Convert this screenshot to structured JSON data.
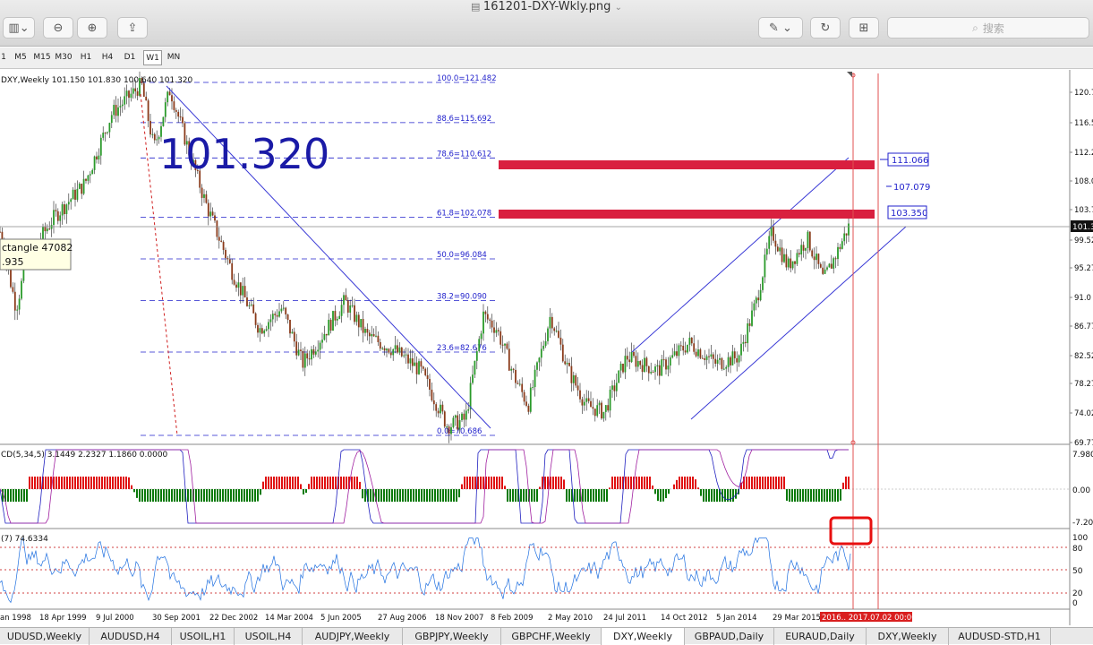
{
  "window": {
    "title": "161201-DXY-Wkly.png",
    "search_placeholder": "搜索"
  },
  "timeframes": [
    {
      "label": "1"
    },
    {
      "label": "M5"
    },
    {
      "label": "M15"
    },
    {
      "label": "M30"
    },
    {
      "label": "H1"
    },
    {
      "label": "H4"
    },
    {
      "label": "D1"
    },
    {
      "label": "W1"
    },
    {
      "label": "MN"
    }
  ],
  "chart": {
    "header": "DXY,Weekly  101.150 101.830 100.640 101.320",
    "big_label": "101.320",
    "tooltip": {
      "line1": "ctangle 47082",
      "line2": ".935"
    },
    "price_axis": [
      "120.7",
      "116.5",
      "112.2",
      "108.0",
      "103.7",
      "99.52",
      "95.27",
      "91.0",
      "86.77",
      "82.52",
      "78.27",
      "74.02",
      "69.77"
    ],
    "current_price": "101.3",
    "fib_levels": [
      {
        "label": "100.0=121.482",
        "price": 121.482
      },
      {
        "label": "88.6=115.692",
        "price": 115.692
      },
      {
        "label": "78.6=110.612",
        "price": 110.612
      },
      {
        "label": "61.8=102.078",
        "price": 102.078
      },
      {
        "label": "50.0=96.084",
        "price": 96.084
      },
      {
        "label": "38.2=90.090",
        "price": 90.09
      },
      {
        "label": "23.6=82.676",
        "price": 82.676
      },
      {
        "label": "0.0=70.686",
        "price": 70.686
      }
    ],
    "boxes": [
      "111.066",
      "107.079",
      "103.350"
    ],
    "macd": {
      "header": "CD(5,34,5) 3.1449 2.2327 1.1860 0.0000",
      "axis": [
        "7.980",
        "0.00",
        "-7.201"
      ]
    },
    "stoch": {
      "header": "(7) 74.6334",
      "axis": [
        "100",
        "80",
        "50",
        "20",
        "0"
      ]
    },
    "dates": [
      "an 1998",
      "18 Apr 1999",
      "9 Jul 2000",
      "30 Sep 2001",
      "22 Dec 2002",
      "14 Mar 2004",
      "5 Jun 2005",
      "27 Aug 2006",
      "18 Nov 2007",
      "8 Feb 2009",
      "2 May 2010",
      "24 Jul 2011",
      "14 Oct 2012",
      "5 Jan 2014",
      "29 Mar 2015"
    ],
    "date_marker": "2016.. 2017.07.02 00:00"
  },
  "tabs": [
    {
      "label": "UDUSD,Weekly"
    },
    {
      "label": "AUDUSD,H4"
    },
    {
      "label": "USOIL,H1"
    },
    {
      "label": "USOIL,H4"
    },
    {
      "label": "AUDJPY,Weekly"
    },
    {
      "label": "GBPJPY,Weekly"
    },
    {
      "label": "GBPCHF,Weekly"
    },
    {
      "label": "DXY,Weekly"
    },
    {
      "label": "GBPAUD,Daily"
    },
    {
      "label": "EURAUD,Daily"
    },
    {
      "label": "DXY,Weekly"
    },
    {
      "label": "AUDUSD-STD,H1"
    }
  ],
  "colors": {
    "price": "#1a1a1a",
    "fib": "#2222cc",
    "zone": "#d91f3f",
    "stoch": "#1e6fe0",
    "macd_pos": "#e01010",
    "macd_neg": "#0a7a0a",
    "signal": "#a020a0"
  }
}
